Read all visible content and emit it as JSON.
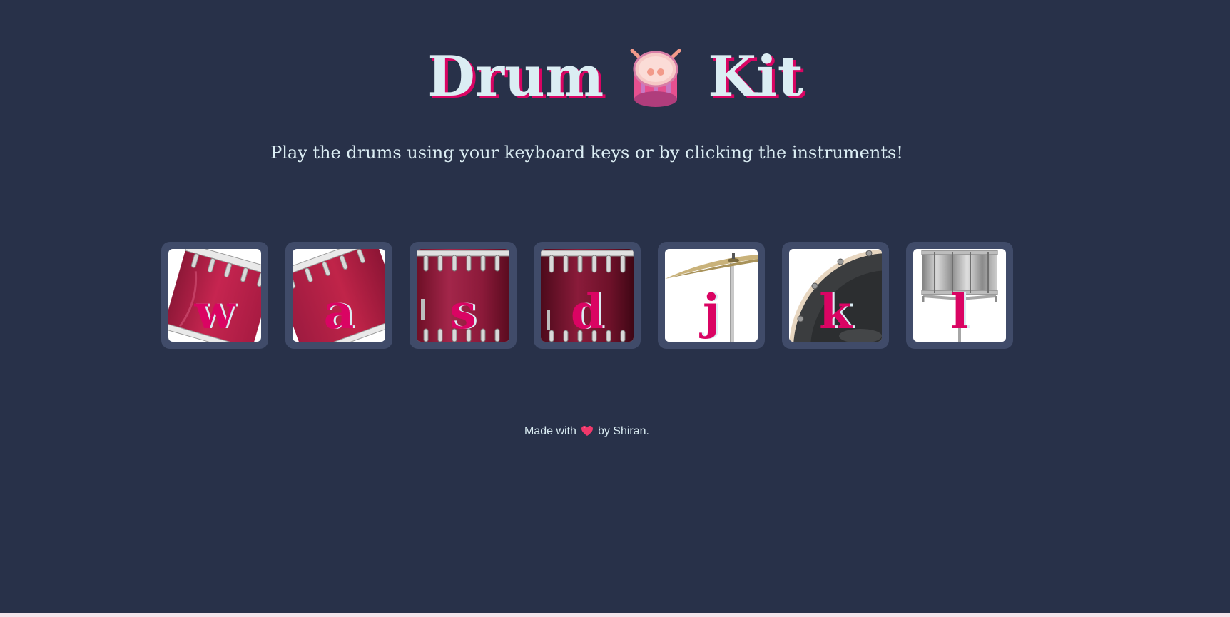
{
  "page": {
    "title_left": "Drum",
    "title_right": "Kit",
    "title_icon": "drum-emoji-icon",
    "subtitle": "Play the drums using your keyboard keys or by clicking the instruments!"
  },
  "drums": [
    {
      "key": "w",
      "instrument_icon": "tom-drum-tilted-icon"
    },
    {
      "key": "a",
      "instrument_icon": "tom-drum-tilted-icon"
    },
    {
      "key": "s",
      "instrument_icon": "snare-drum-icon"
    },
    {
      "key": "d",
      "instrument_icon": "floor-tom-icon"
    },
    {
      "key": "j",
      "instrument_icon": "crash-cymbal-icon"
    },
    {
      "key": "k",
      "instrument_icon": "kick-drum-icon"
    },
    {
      "key": "l",
      "instrument_icon": "snare-on-stand-icon"
    }
  ],
  "footer": {
    "made_with": "Made with",
    "heart_icon": "heart-icon",
    "by": "by Shiran."
  },
  "colors": {
    "background": "#283149",
    "tile": "#404b69",
    "accent": "#da0463",
    "text": "#dbedf3"
  }
}
